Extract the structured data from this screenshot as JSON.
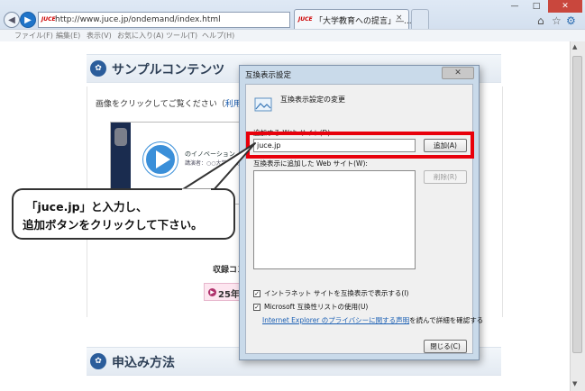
{
  "browser": {
    "url": "http://www.juce.jp/ondemand/index.html",
    "site_badge": "JUCE",
    "address_controls": "⚲ ▾ ↻",
    "tab_title": "「大学教育への提言」―...",
    "tab_close": "×",
    "window_controls": [
      "—",
      "□",
      "✕"
    ],
    "tool_icons": [
      "⌂",
      "☆",
      "⚙"
    ],
    "menu": [
      "ファイル(F)",
      "編集(E)",
      "表示(V)",
      "お気に入り(A)",
      "ツール(T)",
      "ヘルプ(H)"
    ]
  },
  "page": {
    "sample_section_title": "サンプルコンテンツ",
    "intro_text": "画像をクリックしてご覧ください（",
    "intro_link": "利用環境",
    "thumb_caption": "のイノベーション",
    "thumb_caption2": "講演者：○○大学 教授",
    "recording_label": "収録コン",
    "year_button": "25年度",
    "apply_section_title": "申込み方法"
  },
  "callout": {
    "line1": "「juce.jp」と入力し、",
    "line2": "追加ボタンをクリックして下さい。"
  },
  "dialog": {
    "title": "互換表示設定",
    "close_glyph": "✕",
    "heading": "互換表示設定の変更",
    "add_site_label": "追加する Web サイト(D):",
    "site_input_value": "juce.jp",
    "add_button": "追加(A)",
    "added_sites_label": "互換表示に追加した Web サイト(W):",
    "remove_button": "削除(R)",
    "check_intranet": "イントラネット サイトを互換表示で表示する(I)",
    "check_ms_list": "Microsoft 互換性リストの使用(U)",
    "privacy_link": "Internet Explorer のプライバシーに関する声明",
    "privacy_suffix": "を読んで詳細を確認する",
    "close_button": "閉じる(C)",
    "check_mark": "✓"
  },
  "colors": {
    "highlight": "#e8000b",
    "link": "#1a5fb4",
    "dialog_frame": "#c9daea",
    "accent_blue": "#1f74c9"
  },
  "icons": [
    "back-arrow-icon",
    "forward-arrow-icon",
    "site-favicon-icon",
    "search-icon",
    "refresh-icon",
    "home-icon",
    "favorites-star-icon",
    "gear-icon",
    "film-reel-icon",
    "play-icon",
    "compat-view-icon"
  ]
}
